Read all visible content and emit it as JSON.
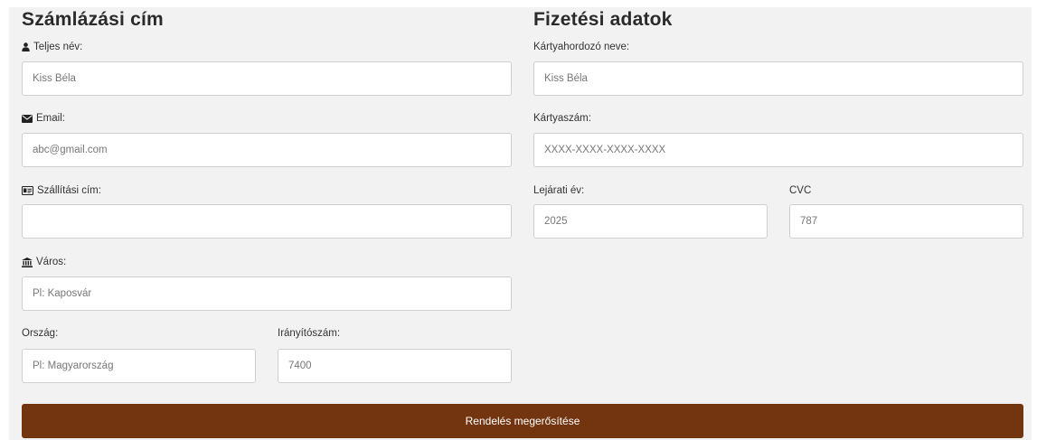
{
  "billing": {
    "title": "Számlázási cím",
    "full_name": {
      "label": "Teljes név:",
      "placeholder": "Kiss Béla",
      "icon": "user-icon"
    },
    "email": {
      "label": "Email:",
      "placeholder": "abc@gmail.com",
      "icon": "envelope-icon"
    },
    "shipping_address": {
      "label": "Szállítási cím:",
      "placeholder": "",
      "icon": "id-card-icon"
    },
    "city": {
      "label": "Város:",
      "placeholder": "Pl: Kaposvár",
      "icon": "bank-icon"
    },
    "country": {
      "label": "Ország:",
      "placeholder": "Pl: Magyarország"
    },
    "zip": {
      "label": "Irányítószám:",
      "placeholder": "7400"
    }
  },
  "payment": {
    "title": "Fizetési adatok",
    "card_holder": {
      "label": "Kártyahordozó neve:",
      "placeholder": "Kiss Béla"
    },
    "card_number": {
      "label": "Kártyaszám:",
      "placeholder": "XXXX-XXXX-XXXX-XXXX"
    },
    "exp_year": {
      "label": "Lejárati év:",
      "placeholder": "2025"
    },
    "cvc": {
      "label": "CVC",
      "placeholder": "787"
    }
  },
  "submit": {
    "label": "Rendelés megerősítése"
  },
  "colors": {
    "panel_background": "#f2f2f2",
    "button_background": "#733510",
    "button_text": "#ffffff"
  }
}
